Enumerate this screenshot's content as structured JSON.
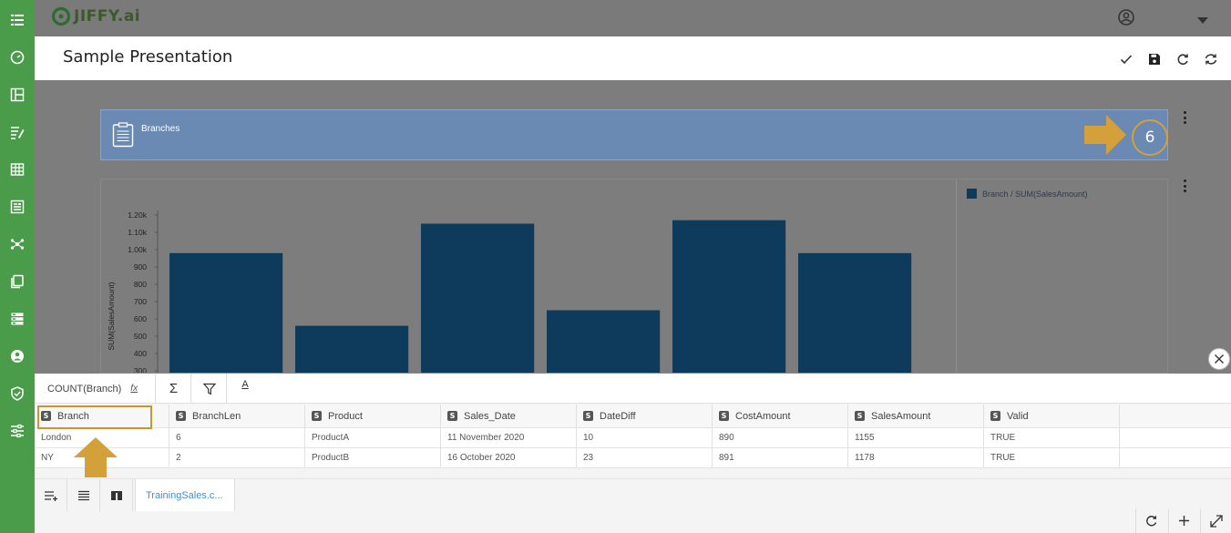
{
  "app": {
    "logo_text": "JIFFY.ai"
  },
  "page": {
    "title": "Sample Presentation"
  },
  "kpi": {
    "label": "Branches",
    "value": "6"
  },
  "chart_data": {
    "type": "bar",
    "ylabel": "SUM(SalesAmount)",
    "legend": [
      "Branch / SUM(SalesAmount)"
    ],
    "legend_position": "top-right",
    "y_ticks": [
      "300",
      "400",
      "500",
      "600",
      "700",
      "800",
      "900",
      "1.00k",
      "1.10k",
      "1.20k"
    ],
    "ylim": [
      300,
      1200
    ],
    "series": [
      {
        "name": "Branch / SUM(SalesAmount)",
        "values": [
          980,
          560,
          1150,
          650,
          1170,
          980
        ]
      }
    ],
    "colors": {
      "bar": "#0e3b5c"
    }
  },
  "toolbar": {
    "formula_text": "COUNT(Branch)",
    "fx_label": "fx",
    "sigma": "Σ",
    "text_format": "A"
  },
  "grid": {
    "columns": [
      "Branch",
      "BranchLen",
      "Product",
      "Sales_Date",
      "DateDiff",
      "CostAmount",
      "SalesAmount",
      "Valid"
    ],
    "type_badge": "S",
    "rows": [
      [
        "London",
        "6",
        "ProductA",
        "11 November 2020",
        "10",
        "890",
        "1155",
        "TRUE"
      ],
      [
        "NY",
        "2",
        "ProductB",
        "16 October 2020",
        "23",
        "891",
        "1178",
        "TRUE"
      ]
    ]
  },
  "sheet_tab": {
    "label": "TrainingSales.c..."
  },
  "colors": {
    "sidebar": "#4a9c4a",
    "kpi_bg": "#6a8ab3",
    "highlight": "#c9962f",
    "bar": "#0e3b5c",
    "tab_text": "#3b8fd6"
  }
}
